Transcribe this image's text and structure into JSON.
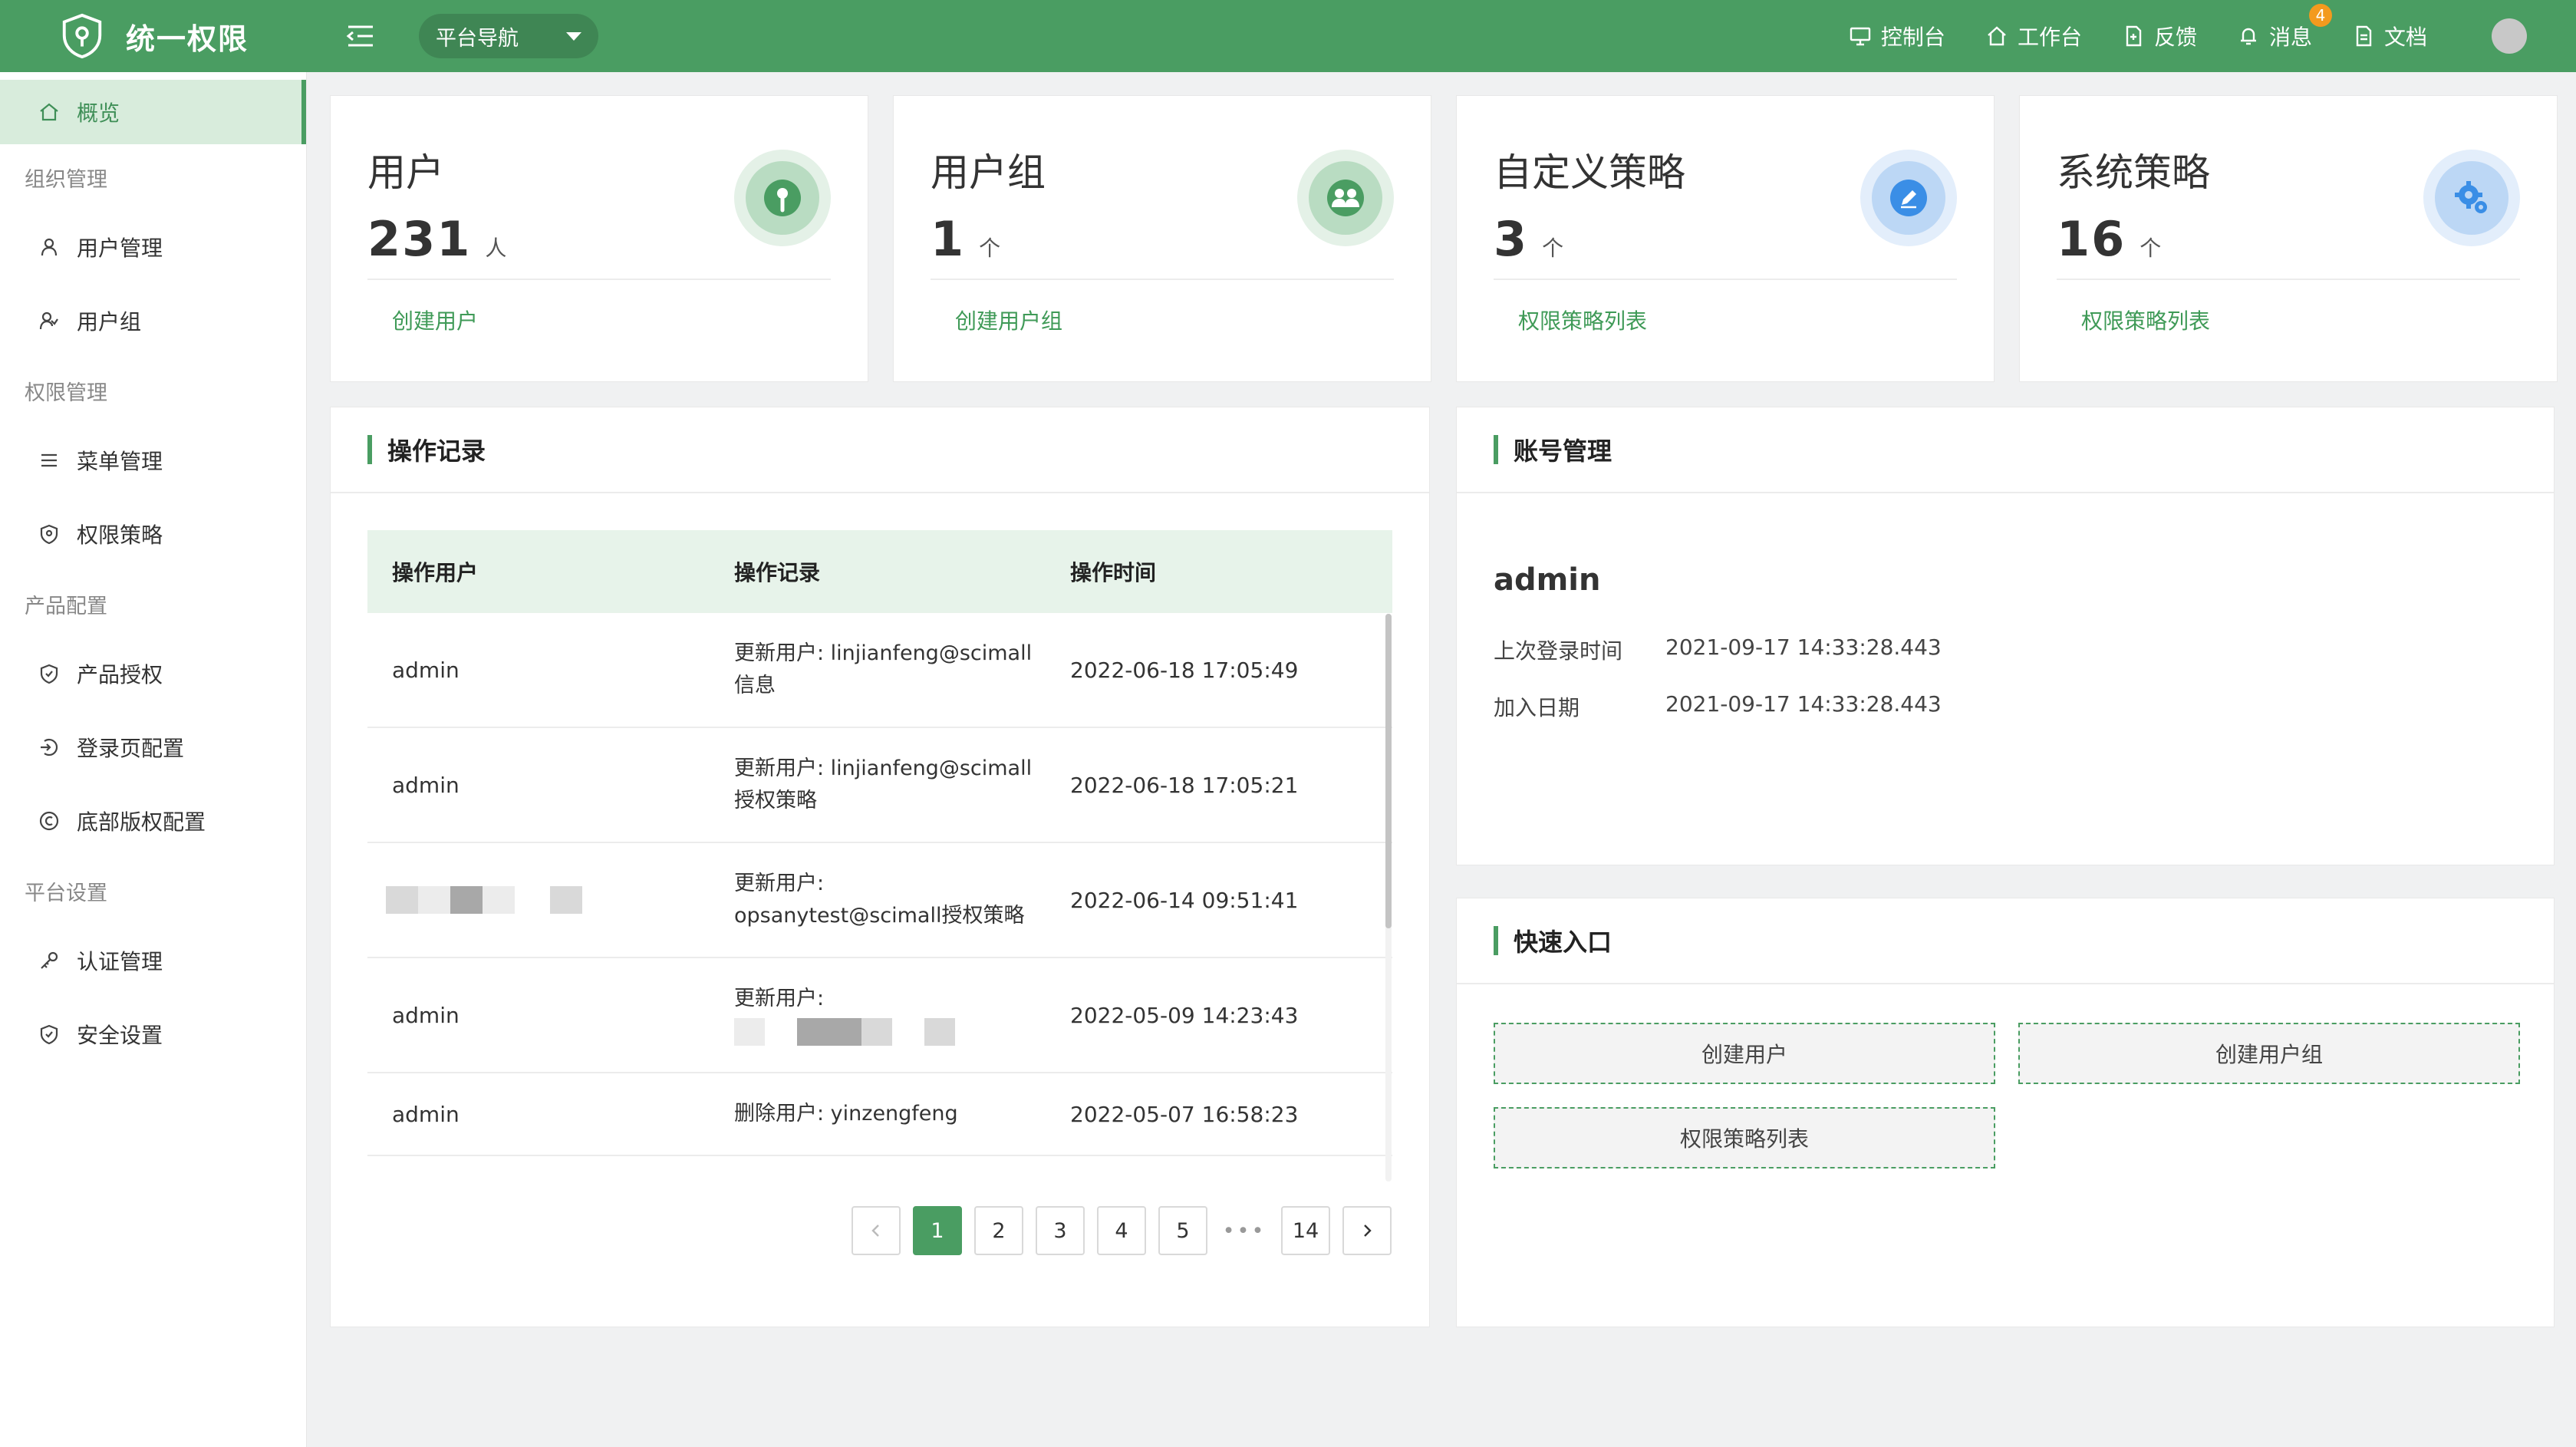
{
  "header": {
    "app_title": "统一权限",
    "nav_select": "平台导航",
    "links": [
      {
        "label": "控制台",
        "icon": "monitor-icon"
      },
      {
        "label": "工作台",
        "icon": "home-icon"
      },
      {
        "label": "反馈",
        "icon": "feedback-icon"
      },
      {
        "label": "消息",
        "icon": "bell-icon",
        "badge": "4"
      },
      {
        "label": "文档",
        "icon": "document-icon"
      }
    ]
  },
  "sidebar": {
    "active": {
      "label": "概览",
      "icon": "home-icon"
    },
    "groups": [
      {
        "title": "组织管理",
        "items": [
          {
            "label": "用户管理",
            "icon": "user-icon"
          },
          {
            "label": "用户组",
            "icon": "user-group-icon"
          }
        ]
      },
      {
        "title": "权限管理",
        "items": [
          {
            "label": "菜单管理",
            "icon": "menu-icon"
          },
          {
            "label": "权限策略",
            "icon": "shield-icon"
          }
        ]
      },
      {
        "title": "产品配置",
        "items": [
          {
            "label": "产品授权",
            "icon": "shield-check-icon"
          },
          {
            "label": "登录页配置",
            "icon": "login-icon"
          },
          {
            "label": "底部版权配置",
            "icon": "copyright-icon"
          }
        ]
      },
      {
        "title": "平台设置",
        "items": [
          {
            "label": "认证管理",
            "icon": "key-icon"
          },
          {
            "label": "安全设置",
            "icon": "security-icon"
          }
        ]
      }
    ]
  },
  "stats": [
    {
      "title": "用户",
      "value": "231",
      "unit": "人",
      "link": "创建用户",
      "icon": "user-pin-icon",
      "color": "#4a9d62"
    },
    {
      "title": "用户组",
      "value": "1",
      "unit": "个",
      "link": "创建用户组",
      "icon": "user-group-icon",
      "color": "#4a9d62"
    },
    {
      "title": "自定义策略",
      "value": "3",
      "unit": "个",
      "link": "权限策略列表",
      "icon": "edit-icon",
      "color": "#3a8ee6"
    },
    {
      "title": "系统策略",
      "value": "16",
      "unit": "个",
      "link": "权限策略列表",
      "icon": "gear-icon",
      "color": "#3a8ee6"
    }
  ],
  "operations": {
    "title": "操作记录",
    "columns": [
      "操作用户",
      "操作记录",
      "操作时间"
    ],
    "rows": [
      {
        "user": "admin",
        "record_line1": "更新用户: linjianfeng@scimall",
        "record_line2": "信息",
        "time": "2022-06-18 17:05:49"
      },
      {
        "user": "admin",
        "record_line1": "更新用户: linjianfeng@scimall",
        "record_line2": "授权策略",
        "time": "2022-06-18 17:05:21"
      },
      {
        "user": "",
        "record_line1": "更新用户:",
        "record_line2": "opsanytest@scimall授权策略",
        "time": "2022-06-14 09:51:41"
      },
      {
        "user": "admin",
        "record_line1": "更新用户:",
        "record_line2": "",
        "time": "2022-05-09 14:23:43"
      },
      {
        "user": "admin",
        "record_line1": "删除用户: yinzengfeng",
        "record_line2": "",
        "time": "2022-05-07 16:58:23"
      }
    ],
    "pager": {
      "pages": [
        "1",
        "2",
        "3",
        "4",
        "5"
      ],
      "dots": "•••",
      "last": "14",
      "current": "1"
    }
  },
  "account": {
    "title": "账号管理",
    "name": "admin",
    "last_login_label": "上次登录时间",
    "last_login": "2021-09-17 14:33:28.443",
    "join_label": "加入日期",
    "join_date": "2021-09-17 14:33:28.443"
  },
  "quick": {
    "title": "快速入口",
    "buttons": [
      "创建用户",
      "创建用户组",
      "权限策略列表"
    ]
  }
}
